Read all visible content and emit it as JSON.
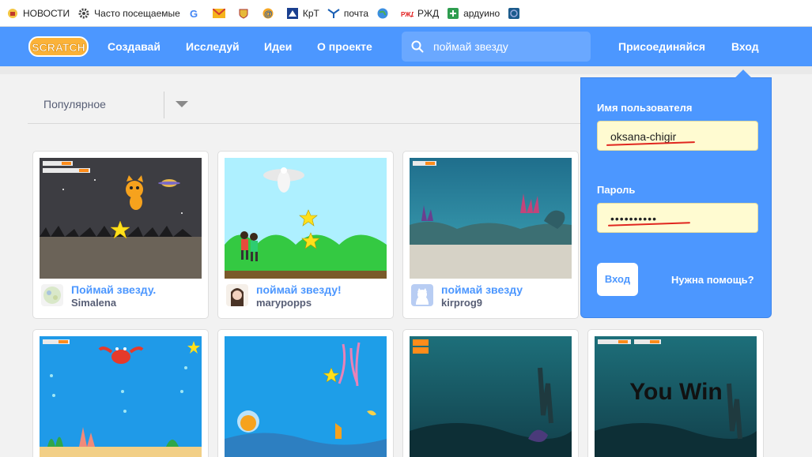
{
  "bookmarks": [
    {
      "label": "НОВОСТИ",
      "icon": "news-icon"
    },
    {
      "label": "Часто посещаемые",
      "icon": "gear-icon"
    },
    {
      "label": "",
      "icon": "google-icon"
    },
    {
      "label": "",
      "icon": "mail-icon"
    },
    {
      "label": "",
      "icon": "emblem-icon"
    },
    {
      "label": "",
      "icon": "at-icon"
    },
    {
      "label": "КрТ",
      "icon": "krt-icon"
    },
    {
      "label": "почта",
      "icon": "post-icon"
    },
    {
      "label": "",
      "icon": "globe-icon"
    },
    {
      "label": "РЖД",
      "icon": "rzd-icon"
    },
    {
      "label": "ардуино",
      "icon": "plus-icon"
    },
    {
      "label": "",
      "icon": "circle-icon"
    }
  ],
  "nav": {
    "logo": "SCRATCH",
    "create": "Создавай",
    "explore": "Исследуй",
    "ideas": "Идеи",
    "about": "О проекте",
    "search_value": "поймай звезду",
    "join": "Присоединяйся",
    "signin": "Вход"
  },
  "filter": {
    "selected": "Популярное"
  },
  "projects": [
    {
      "title": "Поймай звезду.",
      "author": "Simalena"
    },
    {
      "title": "поймай звезду!",
      "author": "marypopps"
    },
    {
      "title": "поймай звезду",
      "author": "kirprog9"
    },
    {
      "title": "",
      "author": ""
    },
    {
      "title": "",
      "author": ""
    },
    {
      "title": "",
      "author": ""
    },
    {
      "title": "",
      "author": ""
    }
  ],
  "thumbs": {
    "you_win": "You Win"
  },
  "login": {
    "username_label": "Имя пользователя",
    "username_value": "oksana-chigir",
    "password_label": "Пароль",
    "password_value": "••••••••••",
    "signin_button": "Вход",
    "help_link": "Нужна помощь?"
  },
  "colors": {
    "scratch_blue": "#4c97ff",
    "underline_green": "#2ecf8f",
    "field_bg": "#fffbd1",
    "annotation_red": "#e0261f"
  }
}
